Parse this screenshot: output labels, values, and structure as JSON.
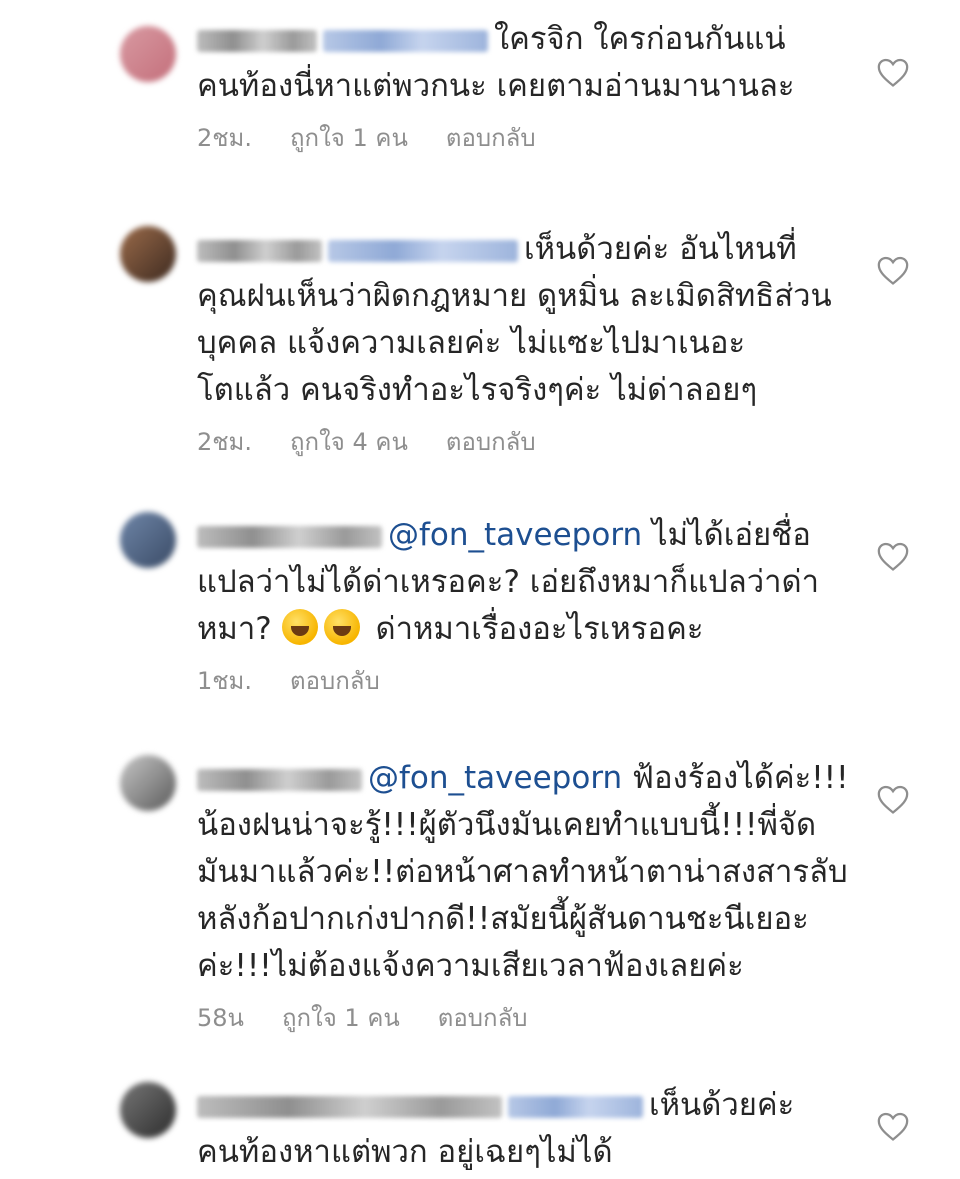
{
  "comments": [
    {
      "lines": [
        "ใครจิก ใครก่อนกันแน่",
        "คนท้องนี่หาแต่พวกนะ  เคยตามอ่านมานานละ"
      ],
      "time": "2ชม.",
      "likes": "ถูกใจ 1 คน",
      "reply": "ตอบกลับ",
      "avatar_colors": [
        "#d89aa2",
        "#c46f7b"
      ]
    },
    {
      "lines": [
        "เห็นด้วยค่ะ อันไหนที่",
        "คุณฝนเห็นว่าผิดกฎหมาย ดูหมิ่น ละเมิดสิทธิส่วน",
        "บุคคล แจ้งความเลยค่ะ ไม่แซะไปมาเนอะ",
        "โตแล้ว คนจริงทำอะไรจริงๆค่ะ ไม่ด่าลอยๆ"
      ],
      "time": "2ชม.",
      "likes": "ถูกใจ 4 คน",
      "reply": "ตอบกลับ",
      "avatar_colors": [
        "#9b6b4a",
        "#3d2a20"
      ]
    },
    {
      "mention": "@fon_taveeporn",
      "lines": [
        "ไม่ได้เอ่ยชื่อ",
        "แปลว่าไม่ได้ด่าเหรอคะ? เอ่ยถึงหมาก็แปลว่าด่า",
        "หมา?",
        "ด่าหมาเรื่องอะไรเหรอคะ"
      ],
      "time": "1ชม.",
      "reply": "ตอบกลับ",
      "avatar_colors": [
        "#6f86a8",
        "#3a4b66"
      ]
    },
    {
      "mention": "@fon_taveeporn",
      "lines": [
        "ฟ้องร้องได้ค่ะ!!!",
        "น้องฝนน่าจะรู้!!!ผู้ตัวนึงมันเคยทำแบบนี้!!!พี่จัด",
        "มันมาแล้วค่ะ!!ต่อหน้าศาลทำหน้าตาน่าสงสารลับ",
        "หลังก้อปากเก่งปากดี!!สมัยนี้ผู้สันดานชะนีเยอะ",
        "ค่ะ!!!ไม่ต้องแจ้งความเสียเวลาฟ้องเลยค่ะ"
      ],
      "time": "58น",
      "likes": "ถูกใจ 1 คน",
      "reply": "ตอบกลับ",
      "avatar_colors": [
        "#c7c7c7",
        "#5a5a5a"
      ]
    },
    {
      "lines": [
        "เห็นด้วยค่ะ",
        "คนท้องหาแต่พวก อยู่เฉยๆไม่ได้"
      ],
      "avatar_colors": [
        "#777777",
        "#2d2d2d"
      ]
    }
  ],
  "icons": {
    "like": "heart-outline-icon"
  },
  "colors": {
    "text": "#262626",
    "meta": "#8e8e8e",
    "mention": "#1d4f91"
  }
}
